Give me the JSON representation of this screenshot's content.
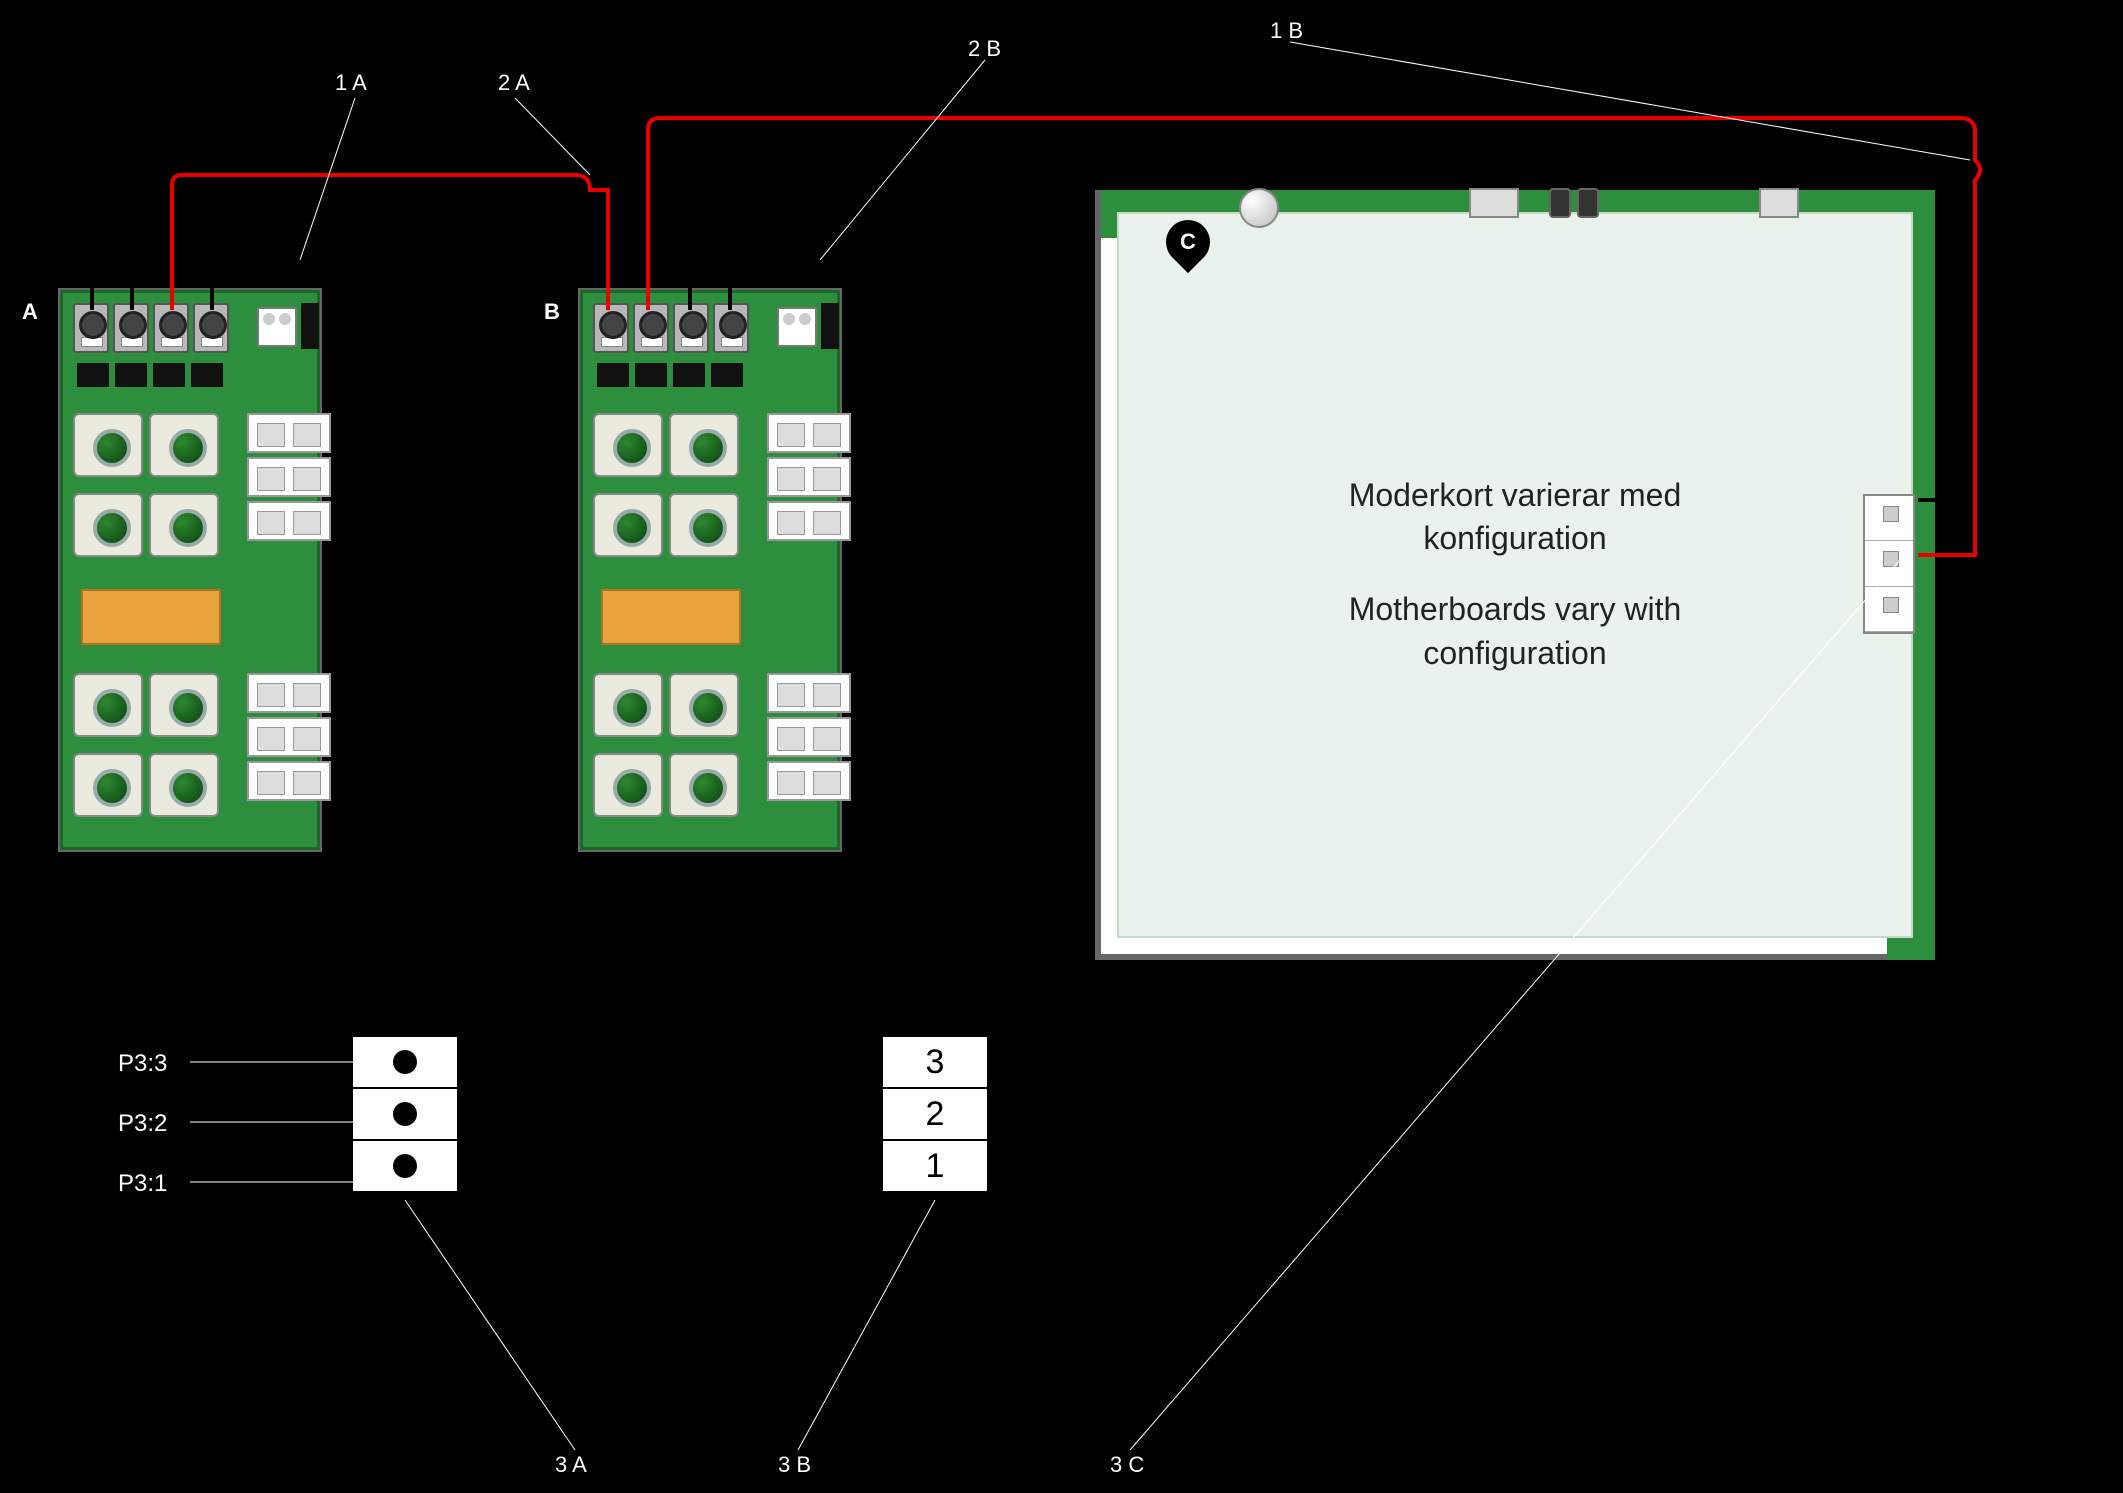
{
  "labels": {
    "top_1A": "1 A",
    "top_2A": "2 A",
    "top_2B": "2 B",
    "top_1B": "1 B",
    "bottom_3A": "3 A",
    "bottom_3B": "3 B",
    "bottom_3C": "3 C"
  },
  "badges": {
    "A": "A",
    "B": "B",
    "C": "C"
  },
  "motherboard": {
    "line1": "Moderkort varierar med",
    "line2": "konfiguration",
    "line3": "Motherboards vary with",
    "line4": "configuration"
  },
  "p3": {
    "r3": "P3:3",
    "r2": "P3:2",
    "r1": "P3:1",
    "n3": "3",
    "n2": "2",
    "n1": "1"
  },
  "colors": {
    "wire_red": "#e80000",
    "wire_black": "#000000",
    "pcb_green": "#2d8f3d"
  }
}
